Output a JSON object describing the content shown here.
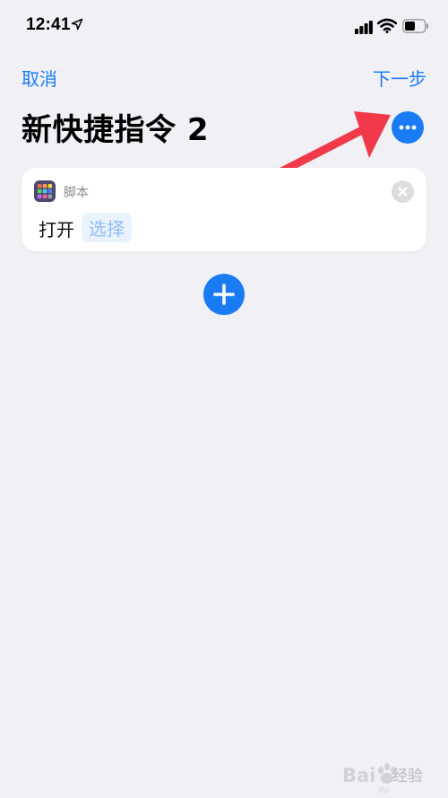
{
  "status_bar": {
    "time": "12:41",
    "icons": [
      "location-arrow-icon",
      "signal-icon",
      "wifi-icon",
      "battery-icon"
    ]
  },
  "nav": {
    "cancel_label": "取消",
    "next_label": "下一步"
  },
  "title": "新快捷指令 2",
  "more_icon": "ellipsis-icon",
  "action": {
    "app_name": "脚本",
    "app_icon": "scripting-app-icon",
    "verb": "打开",
    "parameter": "选择"
  },
  "colors": {
    "accent": "#1a7cf5",
    "background": "#f0f0f5",
    "annotation_arrow": "#f2394a"
  },
  "watermark": {
    "text": "经验",
    "logo": "Bai du"
  }
}
